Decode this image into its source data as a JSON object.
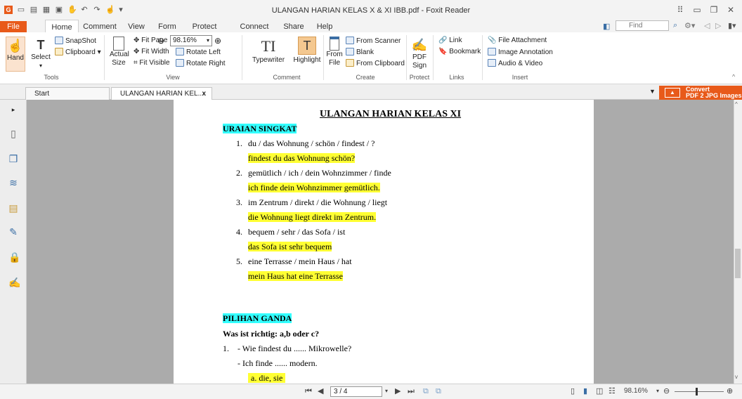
{
  "window": {
    "title": "ULANGAN HARIAN KELAS X & XI IBB.pdf - Foxit Reader"
  },
  "quick_access": [
    "app-logo-icon",
    "open-folder-icon",
    "save-icon",
    "print-icon",
    "fax-icon",
    "hand-icon",
    "undo-icon",
    "redo-icon",
    "cursor-icon",
    "customize-icon"
  ],
  "ribbon_tabs": [
    "File",
    "Home",
    "Comment",
    "View",
    "Form",
    "Protect",
    "Connect",
    "Share",
    "Help"
  ],
  "search": {
    "placeholder": "Find"
  },
  "tools": {
    "hand": "Hand",
    "select": "Select",
    "snapshot": "SnapShot",
    "clipboard": "Clipboard",
    "group": "Tools"
  },
  "view": {
    "actual_size": [
      "Actual",
      "Size"
    ],
    "fit_page": "Fit Page",
    "fit_width": "Fit Width",
    "fit_visible": "Fit Visible",
    "zoom": "98.16%",
    "rotate_left": "Rotate Left",
    "rotate_right": "Rotate Right",
    "group": "View"
  },
  "comment": {
    "typewriter": "Typewriter",
    "highlight": "Highlight",
    "group": "Comment"
  },
  "create": {
    "from_file": [
      "From",
      "File"
    ],
    "from_scanner": "From Scanner",
    "blank": "Blank",
    "from_clipboard": "From Clipboard",
    "group": "Create"
  },
  "protect": {
    "pdf_sign": [
      "PDF",
      "Sign"
    ],
    "group": "Protect"
  },
  "links": {
    "link": "Link",
    "bookmark": "Bookmark",
    "group": "Links"
  },
  "insert": {
    "file_attachment": "File Attachment",
    "image_annotation": "Image Annotation",
    "audio_video": "Audio & Video",
    "group": "Insert"
  },
  "doc_tabs": [
    "Start",
    "ULANGAN HARIAN KEL..."
  ],
  "convert": {
    "line1": "Convert",
    "line2": "PDF 2 JPG Images"
  },
  "document": {
    "heading": "ULANGAN HARIAN KELAS XI",
    "section1": "URAIAN SINGKAT",
    "items": [
      {
        "num": "1.",
        "q": "du / das Wohnung / schön / findest / ?",
        "a": "findest du das Wohnung schön?"
      },
      {
        "num": "2.",
        "q": "gemütlich / ich / dein Wohnzimmer / finde",
        "a": "ich finde dein Wohnzimmer gemütlich."
      },
      {
        "num": "3.",
        "q": "im Zentrum / direkt / die Wohnung / liegt",
        "a": "die Wohnung liegt direkt im Zentrum."
      },
      {
        "num": "4.",
        "q": "bequem / sehr / das Sofa / ist",
        "a": "das Sofa ist sehr bequem"
      },
      {
        "num": "5.",
        "q": "eine Terrasse / mein Haus / hat",
        "a": "mein Haus hat eine Terrasse"
      }
    ],
    "section2": "PILIHAN GANDA",
    "instruction": "Was ist richtig: a,b oder c?",
    "mc_num": "1.",
    "mc_line1": "- Wie findest du ...... Mikrowelle?",
    "mc_line2": "- Ich finde ...... modern.",
    "mc_answer": "a.  die, sie"
  },
  "status": {
    "page": "3 / 4",
    "zoom": "98.16%"
  },
  "colors": {
    "accent": "#e85a1a",
    "answer_highlight": "#ffff33",
    "section_highlight": "#33ffff"
  }
}
